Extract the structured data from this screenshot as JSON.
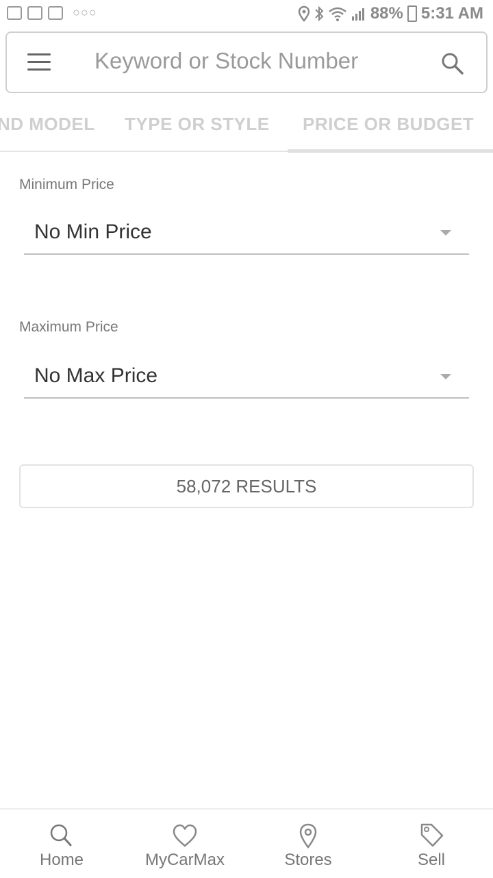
{
  "status_bar": {
    "battery": "88%",
    "time": "5:31 AM",
    "left_icons": [
      "notification-icon",
      "check-notification-icon",
      "mail-icon",
      "more-dots-icon"
    ],
    "right_icons": [
      "location-icon",
      "bluetooth-icon",
      "wifi-icon",
      "signal-icon",
      "battery-icon"
    ]
  },
  "search": {
    "placeholder": "Keyword or Stock Number"
  },
  "tabs": [
    {
      "label": "ND MODEL"
    },
    {
      "label": "TYPE OR STYLE"
    },
    {
      "label": "PRICE OR BUDGET",
      "active": true
    }
  ],
  "form": {
    "min_label": "Minimum Price",
    "min_value": "No Min Price",
    "max_label": "Maximum Price",
    "max_value": "No Max Price"
  },
  "results_button": "58,072 RESULTS",
  "bottom_nav": [
    {
      "label": "Home",
      "icon": "search-icon"
    },
    {
      "label": "MyCarMax",
      "icon": "heart-icon"
    },
    {
      "label": "Stores",
      "icon": "location-pin-icon"
    },
    {
      "label": "Sell",
      "icon": "tag-icon"
    }
  ],
  "colors": {
    "text_primary": "#333333",
    "text_muted": "#777777",
    "divider": "#bfbfbf"
  }
}
